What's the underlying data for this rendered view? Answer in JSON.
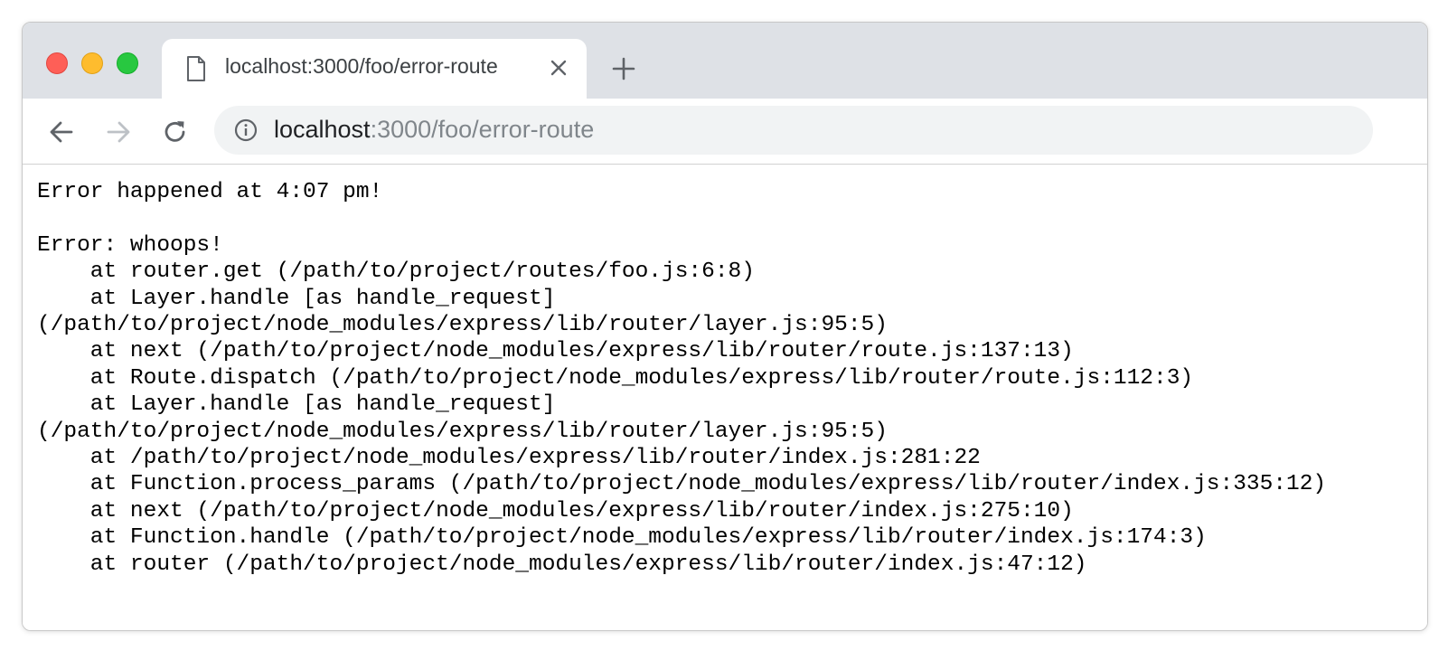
{
  "browser": {
    "window_controls": [
      "close",
      "minimize",
      "maximize"
    ],
    "tab": {
      "title": "localhost:3000/foo/error-route",
      "icon": "document-icon",
      "close_icon": "close-icon"
    },
    "new_tab_icon": "plus-icon",
    "nav": {
      "back_icon": "arrow-left-icon",
      "forward_icon": "arrow-right-icon",
      "reload_icon": "reload-icon"
    },
    "address_bar": {
      "info_icon": "info-icon",
      "host": "localhost",
      "rest": ":3000/foo/error-route"
    }
  },
  "page": {
    "lines": [
      "Error happened at 4:07 pm!",
      "",
      "Error: whoops!",
      "    at router.get (/path/to/project/routes/foo.js:6:8)",
      "    at Layer.handle [as handle_request]",
      "(/path/to/project/node_modules/express/lib/router/layer.js:95:5)",
      "    at next (/path/to/project/node_modules/express/lib/router/route.js:137:13)",
      "    at Route.dispatch (/path/to/project/node_modules/express/lib/router/route.js:112:3)",
      "    at Layer.handle [as handle_request]",
      "(/path/to/project/node_modules/express/lib/router/layer.js:95:5)",
      "    at /path/to/project/node_modules/express/lib/router/index.js:281:22",
      "    at Function.process_params (/path/to/project/node_modules/express/lib/router/index.js:335:12)",
      "    at next (/path/to/project/node_modules/express/lib/router/index.js:275:10)",
      "    at Function.handle (/path/to/project/node_modules/express/lib/router/index.js:174:3)",
      "    at router (/path/to/project/node_modules/express/lib/router/index.js:47:12)"
    ]
  },
  "colors": {
    "titlebar": "#dee1e6",
    "omnibox": "#f1f3f4",
    "url_host": "#202124",
    "url_rest": "#80868b"
  }
}
